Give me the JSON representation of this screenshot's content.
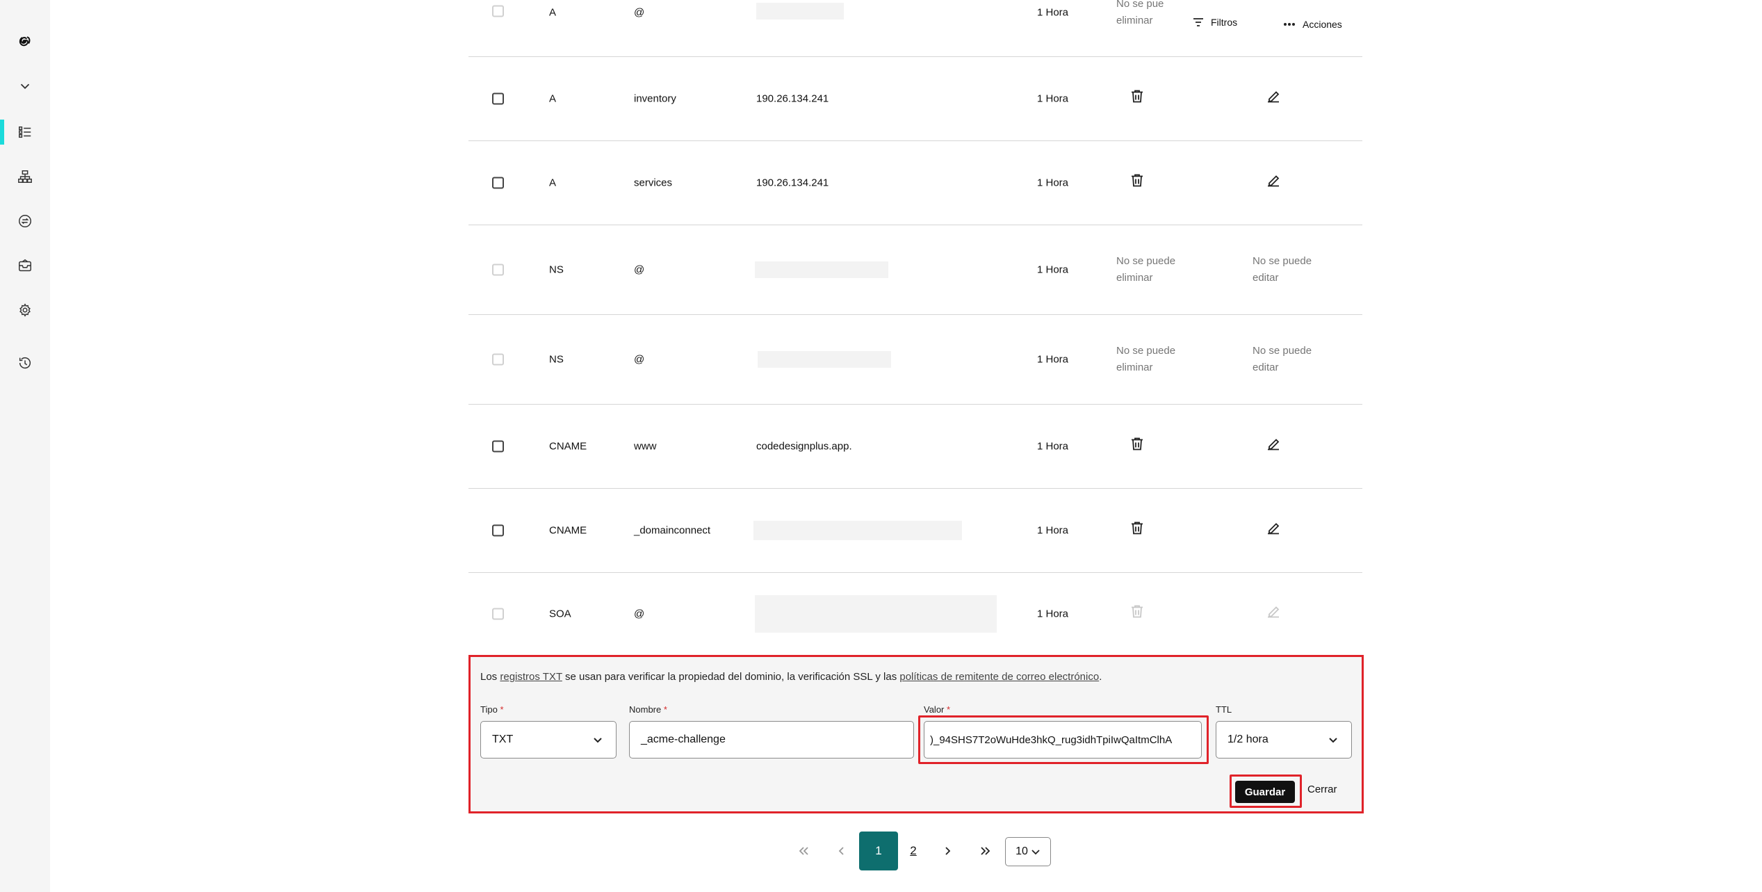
{
  "sidebar": {
    "items": [
      {
        "icon": "logo-icon"
      },
      {
        "icon": "chevron-down-icon"
      },
      {
        "icon": "list-icon"
      },
      {
        "icon": "sitemap-icon"
      },
      {
        "icon": "transfer-icon"
      },
      {
        "icon": "inbox-icon"
      },
      {
        "icon": "gear-icon"
      },
      {
        "icon": "history-icon"
      }
    ],
    "accent_color": "#1bdbdb"
  },
  "toolbar": {
    "filters_label": "Filtros",
    "actions_label": "Acciones"
  },
  "records": [
    {
      "type": "A",
      "name": "@",
      "value": "",
      "ttl": "1 Hora",
      "delete_text": "No se pue eliminar",
      "edit_text": ""
    },
    {
      "type": "A",
      "name": "inventory",
      "value": "190.26.134.241",
      "ttl": "1 Hora"
    },
    {
      "type": "A",
      "name": "services",
      "value": "190.26.134.241",
      "ttl": "1 Hora"
    },
    {
      "type": "NS",
      "name": "@",
      "value": "",
      "ttl": "1 Hora",
      "delete_text": "No se puede eliminar",
      "edit_text": "No se puede editar"
    },
    {
      "type": "NS",
      "name": "@",
      "value": "",
      "ttl": "1 Hora",
      "delete_text": "No se puede eliminar",
      "edit_text": "No se puede editar"
    },
    {
      "type": "CNAME",
      "name": "www",
      "value": "codedesignplus.app.",
      "ttl": "1 Hora"
    },
    {
      "type": "CNAME",
      "name": "_domainconnect",
      "value": "",
      "ttl": "1 Hora"
    },
    {
      "type": "SOA",
      "name": "@",
      "value": "",
      "ttl": "1 Hora"
    }
  ],
  "form": {
    "info_prefix": "Los ",
    "info_link1": "registros TXT",
    "info_middle": " se usan para verificar la propiedad del dominio, la verificación SSL y las ",
    "info_link2": "políticas de remitente de correo electrónico",
    "info_suffix": ".",
    "tipo_label": "Tipo",
    "tipo_value": "TXT",
    "nombre_label": "Nombre",
    "nombre_value": "_acme-challenge",
    "valor_label": "Valor",
    "valor_value": ")_94SHS7T2oWuHde3hkQ_rug3idhTpiIwQaItmClhA",
    "ttl_label": "TTL",
    "ttl_value": "1/2 hora",
    "required_mark": "*",
    "save_label": "Guardar",
    "close_label": "Cerrar",
    "highlight_color": "#e0232a"
  },
  "pagination": {
    "current_page": "1",
    "next_page": "2",
    "page_size": "10",
    "active_color": "#0e6e6e"
  }
}
